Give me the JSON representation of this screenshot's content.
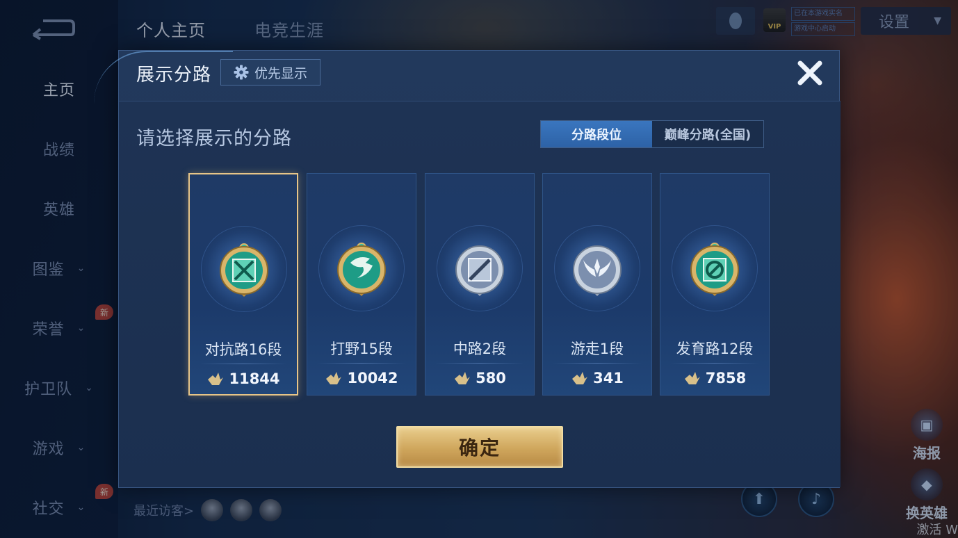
{
  "background": {
    "top_tabs": [
      "个人主页",
      "电竞生涯"
    ],
    "settings_label": "设置",
    "vip_label": "VIP",
    "status_lines": [
      "已在本游戏实名",
      "游戏中心启动"
    ],
    "nav": [
      {
        "label": "主页",
        "has_chevron": false
      },
      {
        "label": "战绩",
        "has_chevron": false
      },
      {
        "label": "英雄",
        "has_chevron": false
      },
      {
        "label": "图鉴",
        "has_chevron": true
      },
      {
        "label": "荣誉",
        "has_chevron": true
      },
      {
        "label": "护卫队",
        "has_chevron": true
      },
      {
        "label": "游戏",
        "has_chevron": true
      },
      {
        "label": "社交",
        "has_chevron": true
      }
    ],
    "new_badge": "新",
    "recent_visitors_label": "最近访客>",
    "right_actions": [
      "海报",
      "换英雄"
    ],
    "watermark": "激活 W"
  },
  "modal": {
    "title": "展示分路",
    "priority_label": "优先显示",
    "subtitle": "请选择展示的分路",
    "tabs": [
      {
        "label": "分路段位",
        "active": true
      },
      {
        "label": "巅峰分路(全国)",
        "active": false
      }
    ],
    "lanes": [
      {
        "name": "对抗路16段",
        "score": "11844",
        "badge": "gold",
        "icon": "crossed-swords-icon",
        "selected": true
      },
      {
        "name": "打野15段",
        "score": "10042",
        "badge": "gold",
        "icon": "dragon-icon",
        "selected": false
      },
      {
        "name": "中路2段",
        "score": "580",
        "badge": "silver",
        "icon": "slash-icon",
        "selected": false
      },
      {
        "name": "游走1段",
        "score": "341",
        "badge": "silver",
        "icon": "wings-icon",
        "selected": false
      },
      {
        "name": "发育路12段",
        "score": "7858",
        "badge": "gold",
        "icon": "s-rune-icon",
        "selected": false
      }
    ],
    "confirm_label": "确定"
  },
  "colors": {
    "gold_frame": "#d9b56a",
    "gold_gem": "#1e9c86",
    "silver_frame": "#c9d3df",
    "silver_gem": "#7c8fae",
    "accent_blue": "#3a76bf"
  }
}
